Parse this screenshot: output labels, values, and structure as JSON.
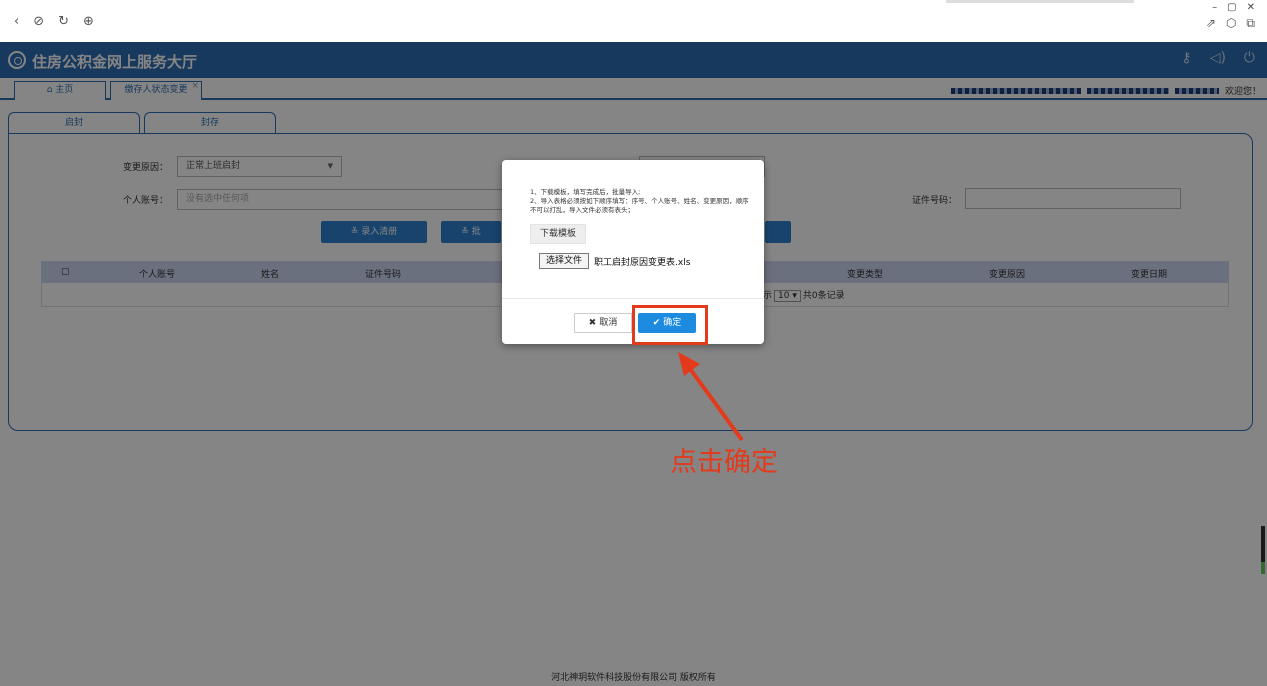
{
  "browser": {
    "wctl": [
      "–",
      "▢",
      "✕"
    ]
  },
  "app": {
    "title": "住房公积金网上服务大厅"
  },
  "tabs": {
    "home": "主页",
    "current": "缴存人状态变更"
  },
  "welcome": "欢迎您！",
  "subtabs": [
    "启封",
    "封存"
  ],
  "form": {
    "reason_label": "变更原因：",
    "reason_value": "正常上班启封",
    "account_label": "个人账号：",
    "account_placeholder": "没有选中任何项",
    "id_label": "证件号码：",
    "btn_entry": "录入清册",
    "btn_batch": "批"
  },
  "grid": {
    "columns": [
      "个人账号",
      "姓名",
      "证件号码",
      "变更类型",
      "变更原因",
      "变更日期"
    ],
    "pager_prefix": "示",
    "page_size": "10",
    "total": "共0条记录"
  },
  "modal": {
    "line1": "1、下载模板，填写完成后，批量导入;",
    "line2": "2、导入表格必须按如下顺序填写：序号、个人账号、姓名、变更原因，顺序不可以打乱，导入文件必须有表头；",
    "download": "下载模板",
    "choose_file": "选择文件",
    "file_name": "职工启封原因变更表.xls",
    "cancel": "取消",
    "ok": "确定"
  },
  "annotation": "点击确定",
  "footer": "河北神玥软件科技股份有限公司 版权所有",
  "colors": {
    "brand": "#2f6db5",
    "accent": "#1d8ce0",
    "highlight": "#e43a1c"
  }
}
